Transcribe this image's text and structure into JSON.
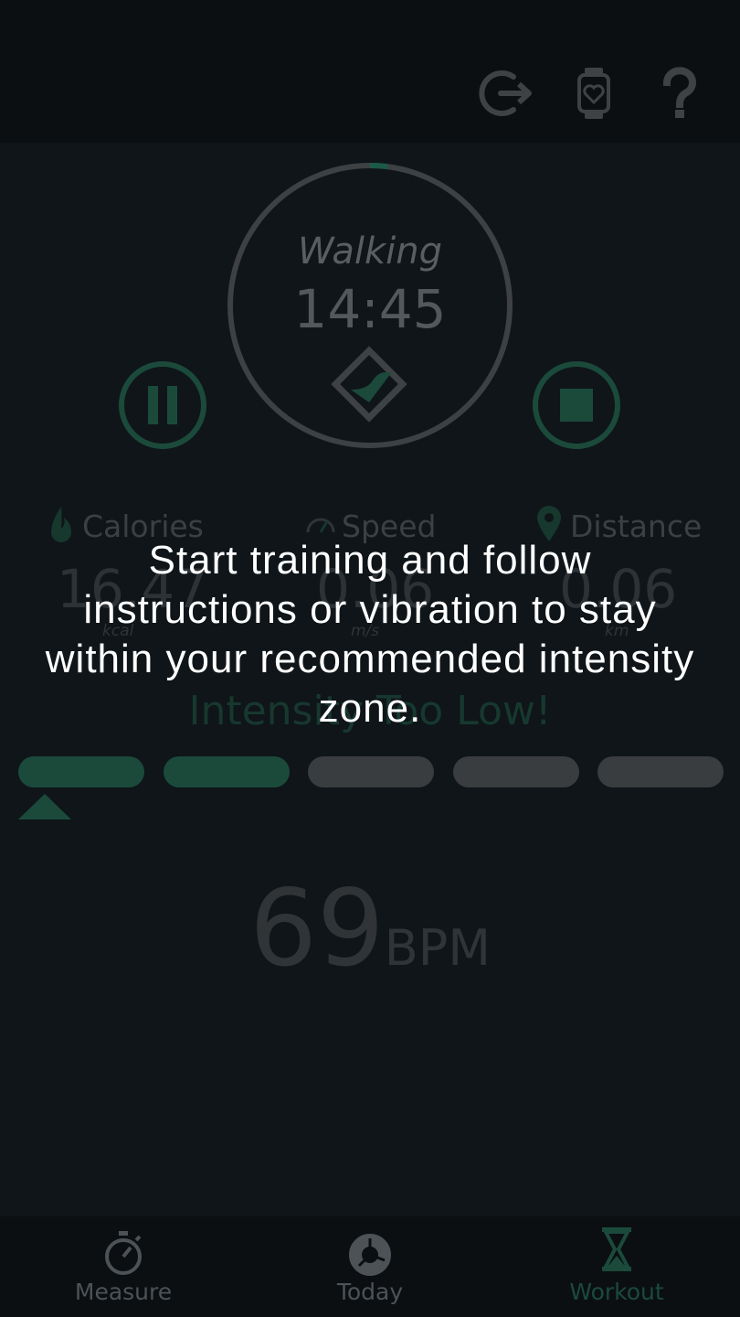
{
  "header": {
    "icons": [
      "exit-icon",
      "watch-heart-icon",
      "help-icon"
    ]
  },
  "workout": {
    "activity": "Walking",
    "elapsed": "14:45",
    "progress_fraction": 0.02
  },
  "stats": [
    {
      "label": "Calories",
      "value": "16.47",
      "unit": "kcal",
      "icon": "flame-icon"
    },
    {
      "label": "Speed",
      "value": "0.06",
      "unit": "m/s",
      "icon": "speedometer-icon"
    },
    {
      "label": "Distance",
      "value": "0.06",
      "unit": "km",
      "icon": "location-pin-icon"
    }
  ],
  "zone": {
    "status": "Intensity Too Low!",
    "active_bars": 2,
    "total_bars": 5,
    "current_zone_index": 0
  },
  "heart_rate": {
    "value": "69",
    "unit": "BPM"
  },
  "overlay": {
    "message": "Start training and follow instructions or vibration to stay within your recommended intensity zone."
  },
  "nav": {
    "items": [
      {
        "label": "Measure",
        "icon": "stopwatch-icon",
        "active": false
      },
      {
        "label": "Today",
        "icon": "donut-chart-icon",
        "active": false
      },
      {
        "label": "Workout",
        "icon": "hourglass-icon",
        "active": true
      }
    ]
  },
  "colors": {
    "accent": "#1b4a3b",
    "overlay_text": "#ffffff",
    "inactive_bar": "#3a3d40",
    "nav_inactive": "#4d5256"
  }
}
